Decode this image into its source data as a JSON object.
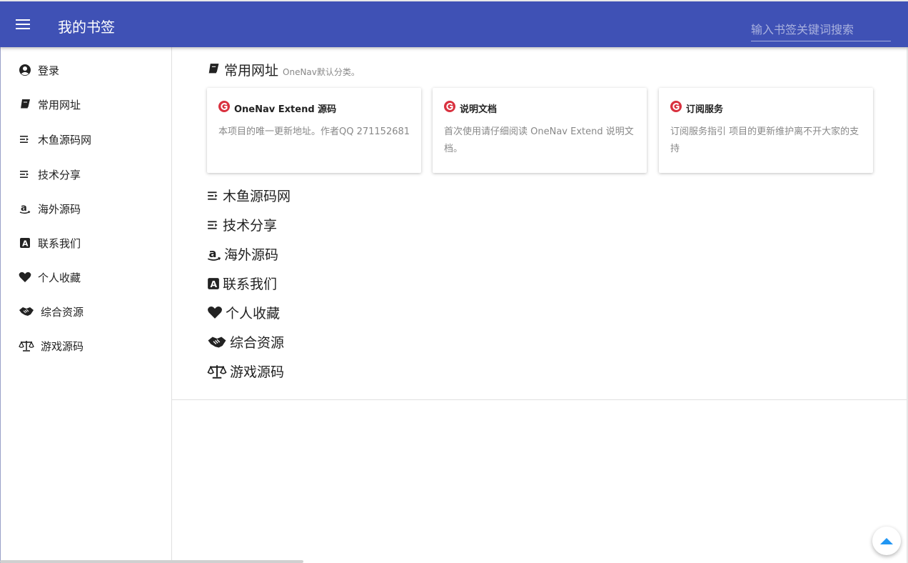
{
  "header": {
    "title": "我的书签",
    "search_placeholder": "输入书签关键词搜索",
    "accent": "#3f51b5"
  },
  "sidebar": {
    "items": [
      {
        "label": "登录",
        "icon": "user-circle-icon"
      },
      {
        "label": "常用网址",
        "icon": "book-icon"
      },
      {
        "label": "木鱼源码网",
        "icon": "list-icon"
      },
      {
        "label": "技术分享",
        "icon": "list-icon"
      },
      {
        "label": "海外源码",
        "icon": "amazon-icon"
      },
      {
        "label": "联系我们",
        "icon": "font-a-icon"
      },
      {
        "label": "个人收藏",
        "icon": "heart-icon"
      },
      {
        "label": "综合资源",
        "icon": "handshake-icon"
      },
      {
        "label": "游戏源码",
        "icon": "balance-scale-icon"
      }
    ]
  },
  "main": {
    "category": {
      "title": "常用网址",
      "subtitle": "OneNav默认分类。",
      "icon": "book-icon"
    },
    "cards": [
      {
        "title": "OneNav Extend 源码",
        "desc": "本项目的唯一更新地址。作者QQ 271152681",
        "icon": "site-logo-icon"
      },
      {
        "title": "说明文档",
        "desc": "首次使用请仔细阅读 OneNav Extend 说明文档。",
        "icon": "site-logo-icon"
      },
      {
        "title": "订阅服务",
        "desc": "订阅服务指引 项目的更新维护离不开大家的支持",
        "icon": "site-logo-icon"
      }
    ],
    "categories": [
      {
        "label": "木鱼源码网",
        "icon": "list-icon"
      },
      {
        "label": "技术分享",
        "icon": "list-icon"
      },
      {
        "label": "海外源码",
        "icon": "amazon-icon"
      },
      {
        "label": "联系我们",
        "icon": "font-a-icon"
      },
      {
        "label": "个人收藏",
        "icon": "heart-icon"
      },
      {
        "label": "综合资源",
        "icon": "handshake-icon"
      },
      {
        "label": "游戏源码",
        "icon": "balance-scale-icon"
      }
    ]
  },
  "colors": {
    "logo_red": "#d9313f",
    "fab_arrow": "#2196f3"
  }
}
